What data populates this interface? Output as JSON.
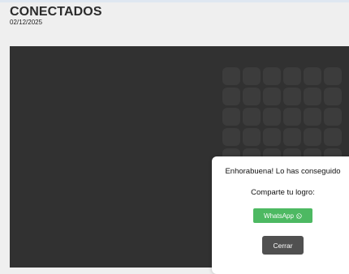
{
  "header": {
    "title": "CONECTADOS",
    "date": "02/12/2025"
  },
  "board": {
    "rows": 5,
    "cols": 6
  },
  "modal": {
    "title": "Enhorabuena! Lo has conseguido",
    "share_label": "Comparte tu logro:",
    "whatsapp_label": "WhatsApp",
    "whatsapp_icon": "whatsapp-icon",
    "close_label": "Cerrar"
  },
  "colors": {
    "board_bg": "#313131",
    "cell_bg": "#3c3c3c",
    "whatsapp_green": "#4db962",
    "close_button": "#505050"
  }
}
